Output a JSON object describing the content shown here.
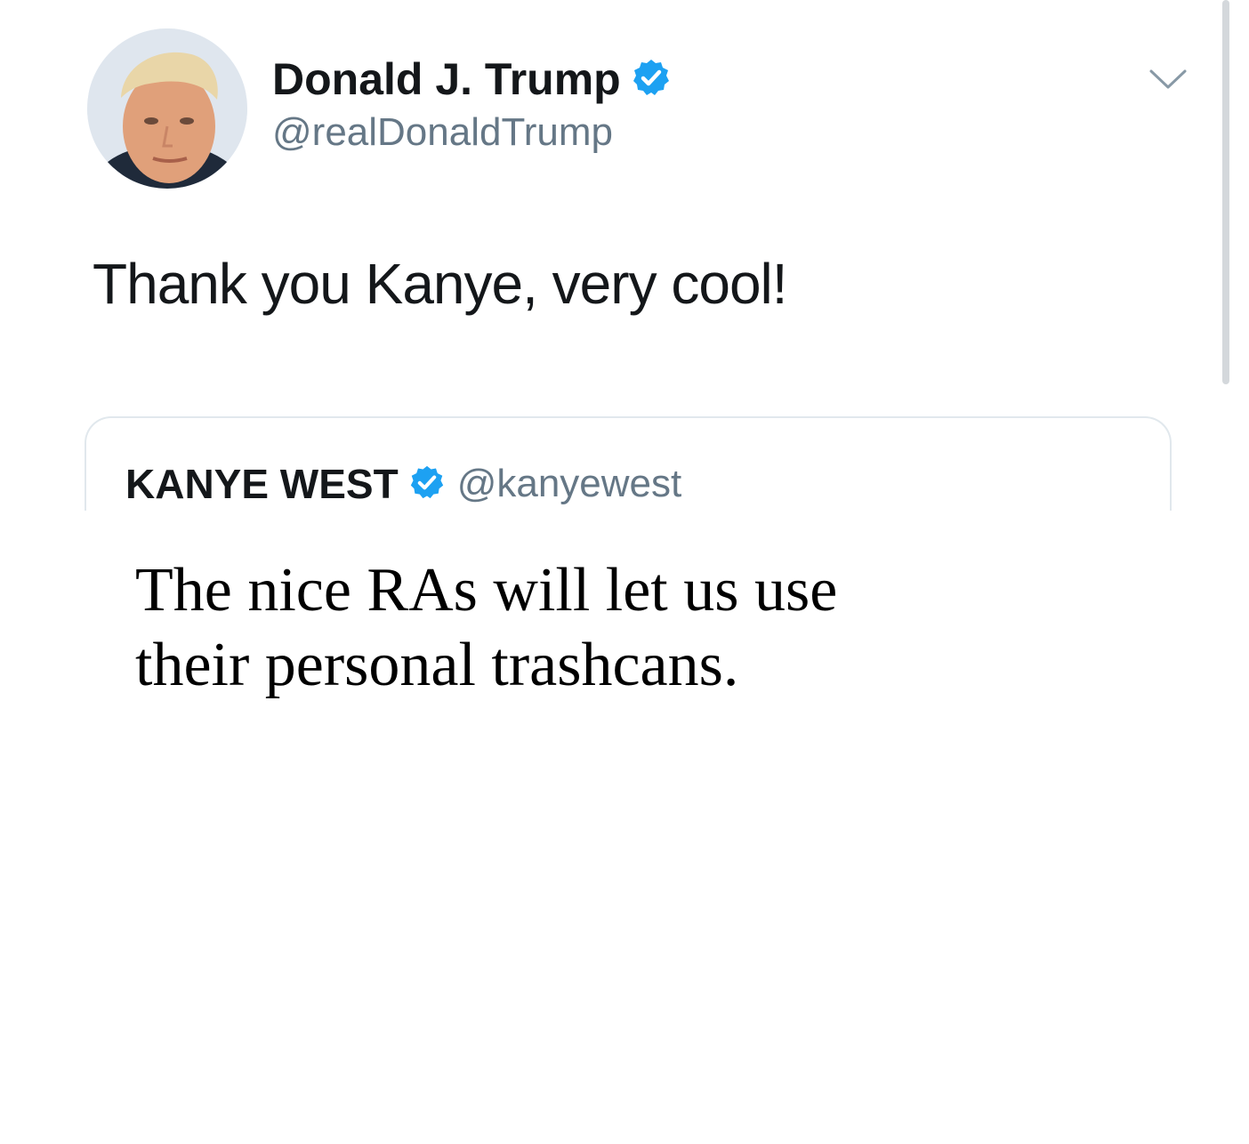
{
  "tweet": {
    "display_name": "Donald J. Trump",
    "handle": "@realDonaldTrump",
    "text": "Thank you Kanye, very cool!",
    "verified": true,
    "accent_color": "#1da1f2"
  },
  "quoted_tweet": {
    "display_name": "KANYE WEST",
    "handle": "@kanyewest",
    "verified": true
  },
  "icons": {
    "menu": "chevron-down-icon",
    "badge": "verified-badge-icon"
  },
  "caption": {
    "line_1": "The nice RAs will let us use",
    "line_2": "their personal trashcans."
  }
}
